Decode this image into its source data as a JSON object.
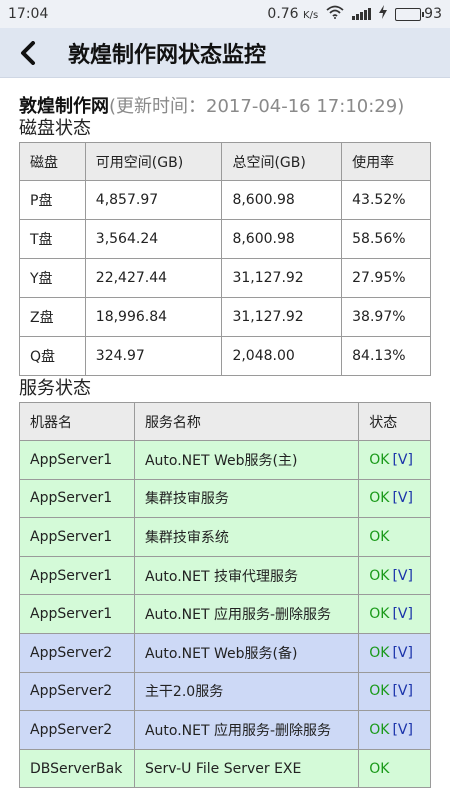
{
  "status_bar": {
    "time": "17:04",
    "net_speed": "0.76",
    "net_unit": "K/s",
    "battery": "93",
    "battery_level": 0.93
  },
  "header": {
    "title": "敦煌制作网状态监控"
  },
  "site": {
    "name": "敦煌制作网",
    "update_time": "(更新时间：2017-04-16 17:10:29)"
  },
  "disk": {
    "section_title": "磁盘状态",
    "columns": [
      "磁盘",
      "可用空间(GB)",
      "总空间(GB)",
      "使用率"
    ],
    "rows": [
      [
        "P盘",
        "4,857.97",
        "8,600.98",
        "43.52%"
      ],
      [
        "T盘",
        "3,564.24",
        "8,600.98",
        "58.56%"
      ],
      [
        "Y盘",
        "22,427.44",
        "31,127.92",
        "27.95%"
      ],
      [
        "Z盘",
        "18,996.84",
        "31,127.92",
        "38.97%"
      ],
      [
        "Q盘",
        "324.97",
        "2,048.00",
        "84.13%"
      ]
    ]
  },
  "services": {
    "section_title": "服务状态",
    "columns": [
      "机器名",
      "服务名称",
      "状态"
    ],
    "rows": [
      {
        "machine": "AppServer1",
        "service": "Auto.NET Web服务(主)",
        "status": "OK",
        "link": "[V]",
        "group": "g"
      },
      {
        "machine": "AppServer1",
        "service": "集群技审服务",
        "status": "OK",
        "link": "[V]",
        "group": "g"
      },
      {
        "machine": "AppServer1",
        "service": "集群技审系统",
        "status": "OK",
        "link": "",
        "group": "g"
      },
      {
        "machine": "AppServer1",
        "service": "Auto.NET 技审代理服务",
        "status": "OK",
        "link": "[V]",
        "group": "g"
      },
      {
        "machine": "AppServer1",
        "service": "Auto.NET 应用服务-删除服务",
        "status": "OK",
        "link": "[V]",
        "group": "g"
      },
      {
        "machine": "AppServer2",
        "service": "Auto.NET Web服务(备)",
        "status": "OK",
        "link": "[V]",
        "group": "b"
      },
      {
        "machine": "AppServer2",
        "service": "主干2.0服务",
        "status": "OK",
        "link": "[V]",
        "group": "b"
      },
      {
        "machine": "AppServer2",
        "service": "Auto.NET 应用服务-删除服务",
        "status": "OK",
        "link": "[V]",
        "group": "b"
      },
      {
        "machine": "DBServerBak",
        "service": "Serv-U File Server EXE",
        "status": "OK",
        "link": "",
        "group": "g"
      }
    ]
  },
  "colors": {
    "green_row": "#d4fad8",
    "blue_row": "#cdd9f6",
    "ok_text": "#1a9a1a",
    "link_text": "#1a33aa"
  }
}
